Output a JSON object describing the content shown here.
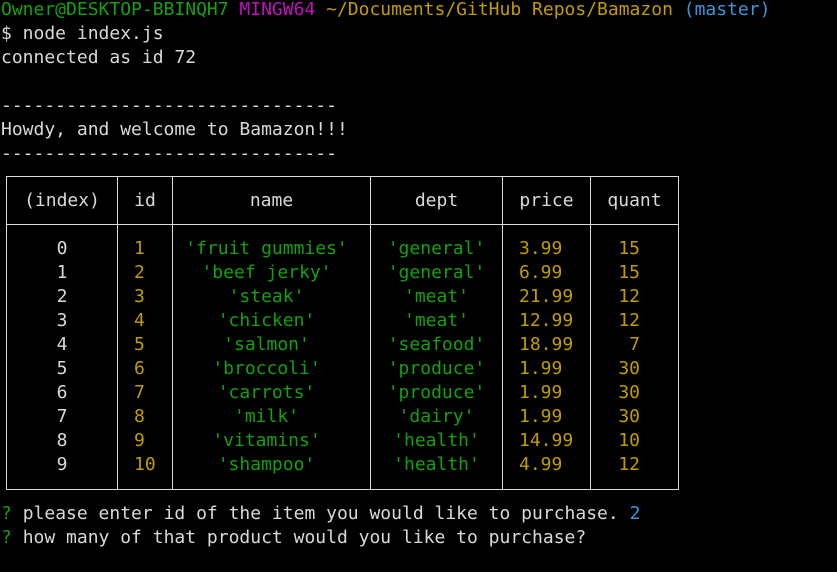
{
  "prompt": {
    "user_host": "Owner@DESKTOP-BBINQH7",
    "shell": "MINGW64",
    "path": "~/Documents/GitHub Repos/Bamazon",
    "branch": "(master)"
  },
  "command": "$ node index.js",
  "connection": "connected as id 72",
  "banner": {
    "rule_top": "-------------------------------",
    "message": "Howdy, and welcome to Bamazon!!!",
    "rule_bottom": "-------------------------------"
  },
  "table": {
    "headers": [
      "(index)",
      "id",
      "name",
      "dept",
      "price",
      "quant"
    ],
    "rows": [
      {
        "index": "0",
        "id": "1",
        "name": "'fruit gummies'",
        "dept": "'general'",
        "price": "3.99",
        "quant": "15"
      },
      {
        "index": "1",
        "id": "2",
        "name": "'beef jerky'",
        "dept": "'general'",
        "price": "6.99",
        "quant": "15"
      },
      {
        "index": "2",
        "id": "3",
        "name": "'steak'",
        "dept": "'meat'",
        "price": "21.99",
        "quant": "12"
      },
      {
        "index": "3",
        "id": "4",
        "name": "'chicken'",
        "dept": "'meat'",
        "price": "12.99",
        "quant": "12"
      },
      {
        "index": "4",
        "id": "5",
        "name": "'salmon'",
        "dept": "'seafood'",
        "price": "18.99",
        "quant": "7"
      },
      {
        "index": "5",
        "id": "6",
        "name": "'broccoli'",
        "dept": "'produce'",
        "price": "1.99",
        "quant": "30"
      },
      {
        "index": "6",
        "id": "7",
        "name": "'carrots'",
        "dept": "'produce'",
        "price": "1.99",
        "quant": "30"
      },
      {
        "index": "7",
        "id": "8",
        "name": "'milk'",
        "dept": "'dairy'",
        "price": "1.99",
        "quant": "30"
      },
      {
        "index": "8",
        "id": "9",
        "name": "'vitamins'",
        "dept": "'health'",
        "price": "14.99",
        "quant": "10"
      },
      {
        "index": "9",
        "id": "10",
        "name": "'shampoo'",
        "dept": "'health'",
        "price": "4.99",
        "quant": "12"
      }
    ]
  },
  "questions": [
    {
      "marker": "?",
      "text": "please enter id of the item you would like to purchase.",
      "answer": "2"
    },
    {
      "marker": "?",
      "text": "how many of that product would you like to purchase?",
      "answer": ""
    }
  ],
  "colors": {
    "background": "#000000",
    "foreground": "#d9d9d9",
    "green": "#13a10e",
    "purple": "#c20fc0",
    "yellow": "#c19c00",
    "cyan": "#3a96dd"
  }
}
